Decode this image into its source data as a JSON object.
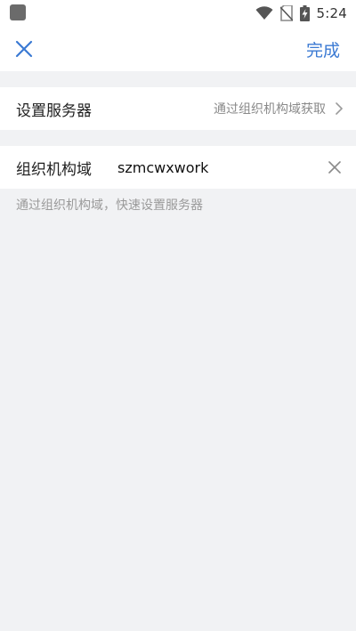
{
  "status_bar": {
    "time": "5:24",
    "icons": [
      "app-notification-icon",
      "wifi-icon",
      "no-sim-icon",
      "battery-charging-icon"
    ]
  },
  "nav": {
    "close_icon": "close-icon",
    "done_label": "完成",
    "accent_color": "#3b7ad3"
  },
  "server_row": {
    "label": "设置服务器",
    "value": "通过组织机构域获取"
  },
  "domain_row": {
    "label": "组织机构域",
    "input_value": "szmcwxwork"
  },
  "hint_text": "通过组织机构域，快速设置服务器"
}
